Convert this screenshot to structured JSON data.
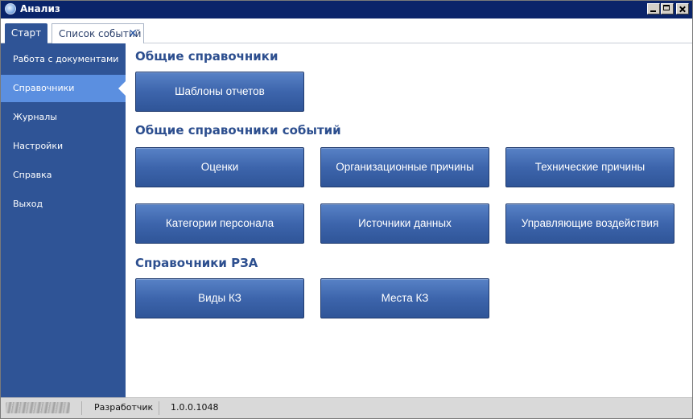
{
  "window": {
    "title": "Анализ"
  },
  "tabs": [
    {
      "label": "Старт"
    },
    {
      "label": "Список событий"
    }
  ],
  "sidebar": {
    "items": [
      {
        "label": "Работа с документами"
      },
      {
        "label": "Справочники"
      },
      {
        "label": "Журналы"
      },
      {
        "label": "Настройки"
      },
      {
        "label": "Справка"
      },
      {
        "label": "Выход"
      }
    ],
    "active": "Справочники"
  },
  "sections": [
    {
      "title": "Общие справочники",
      "buttons": [
        "Шаблоны отчетов"
      ]
    },
    {
      "title": "Общие справочники событий",
      "buttons": [
        "Оценки",
        "Организационные причины",
        "Технические причины",
        "Категории персонала",
        "Источники данных",
        "Управляющие воздействия"
      ]
    },
    {
      "title": "Справочники РЗА",
      "buttons": [
        "Виды КЗ",
        "Места КЗ"
      ]
    }
  ],
  "statusbar": {
    "role": "Разработчик",
    "version": "1.0.0.1048"
  },
  "colors": {
    "sidebar": "#2f5496",
    "active_item": "#5b8fe0",
    "button": "#3d65ac",
    "heading": "#2d4f8f",
    "titlebar": "#0a246a"
  }
}
